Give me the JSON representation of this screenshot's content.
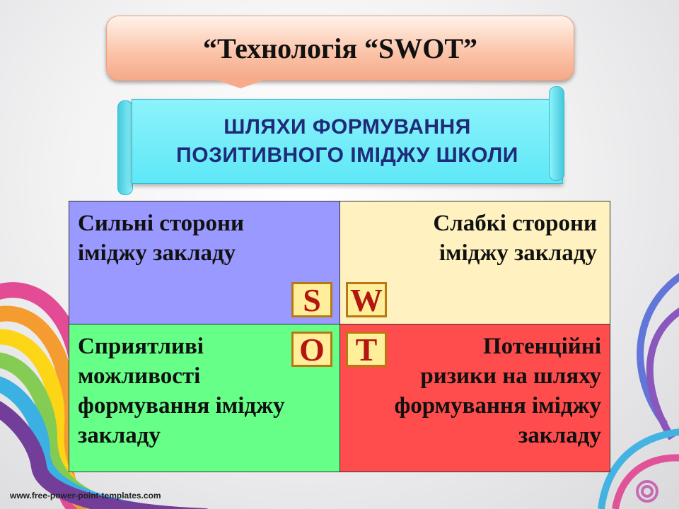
{
  "slide": {
    "title": "“Технологія “SWOT”",
    "subtitle_line1": "ШЛЯХИ ФОРМУВАННЯ",
    "subtitle_line2": "ПОЗИТИВНОГО ІМІДЖУ ШКОЛИ"
  },
  "swot": {
    "strengths": {
      "letter": "S",
      "text": "Сильні сторони\nіміджу закладу",
      "color": "#9999ff"
    },
    "weaknesses": {
      "letter": "W",
      "text": "Слабкі сторони\nіміджу закладу",
      "color": "#fff2c0"
    },
    "opportunities": {
      "letter": "O",
      "text": "Сприятливі\nможливості\nформування іміджу\nзакладу",
      "color": "#66ff88"
    },
    "threats": {
      "letter": "T",
      "text": "Потенційні\nризики на шляху\nформування іміджу\nзакладу",
      "color": "#ff4c4c"
    }
  },
  "footer": {
    "url": "www.free-power-point-templates.com"
  },
  "colors": {
    "letter_text": "#b3150f",
    "letter_bg": "#ffee9a",
    "subtitle_text": "#1f2b78"
  }
}
